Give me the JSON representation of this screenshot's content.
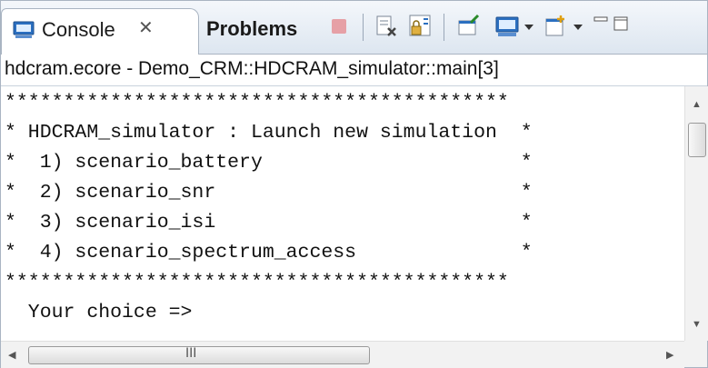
{
  "tabs": {
    "console_label": "Console",
    "console_close": "✕",
    "problems_label": "Problems"
  },
  "path": "hdcram.ecore - Demo_CRM::HDCRAM_simulator::main[3]",
  "console_lines": [
    "*******************************************",
    "* HDCRAM_simulator : Launch new simulation  *",
    "*  1) scenario_battery                      *",
    "*  2) scenario_snr                          *",
    "*  3) scenario_isi                          *",
    "*  4) scenario_spectrum_access              *",
    "*******************************************",
    "  Your choice =>"
  ],
  "scroll": {
    "grip": "III"
  },
  "icons": {
    "console": "console-icon",
    "stop": "stop-icon",
    "remove": "remove-launch-icon",
    "scroll_lock": "scroll-lock-icon",
    "pin": "pin-icon",
    "display": "display-console-icon",
    "open": "open-console-icon",
    "minimize": "minimize-icon",
    "maximize": "maximize-icon"
  }
}
